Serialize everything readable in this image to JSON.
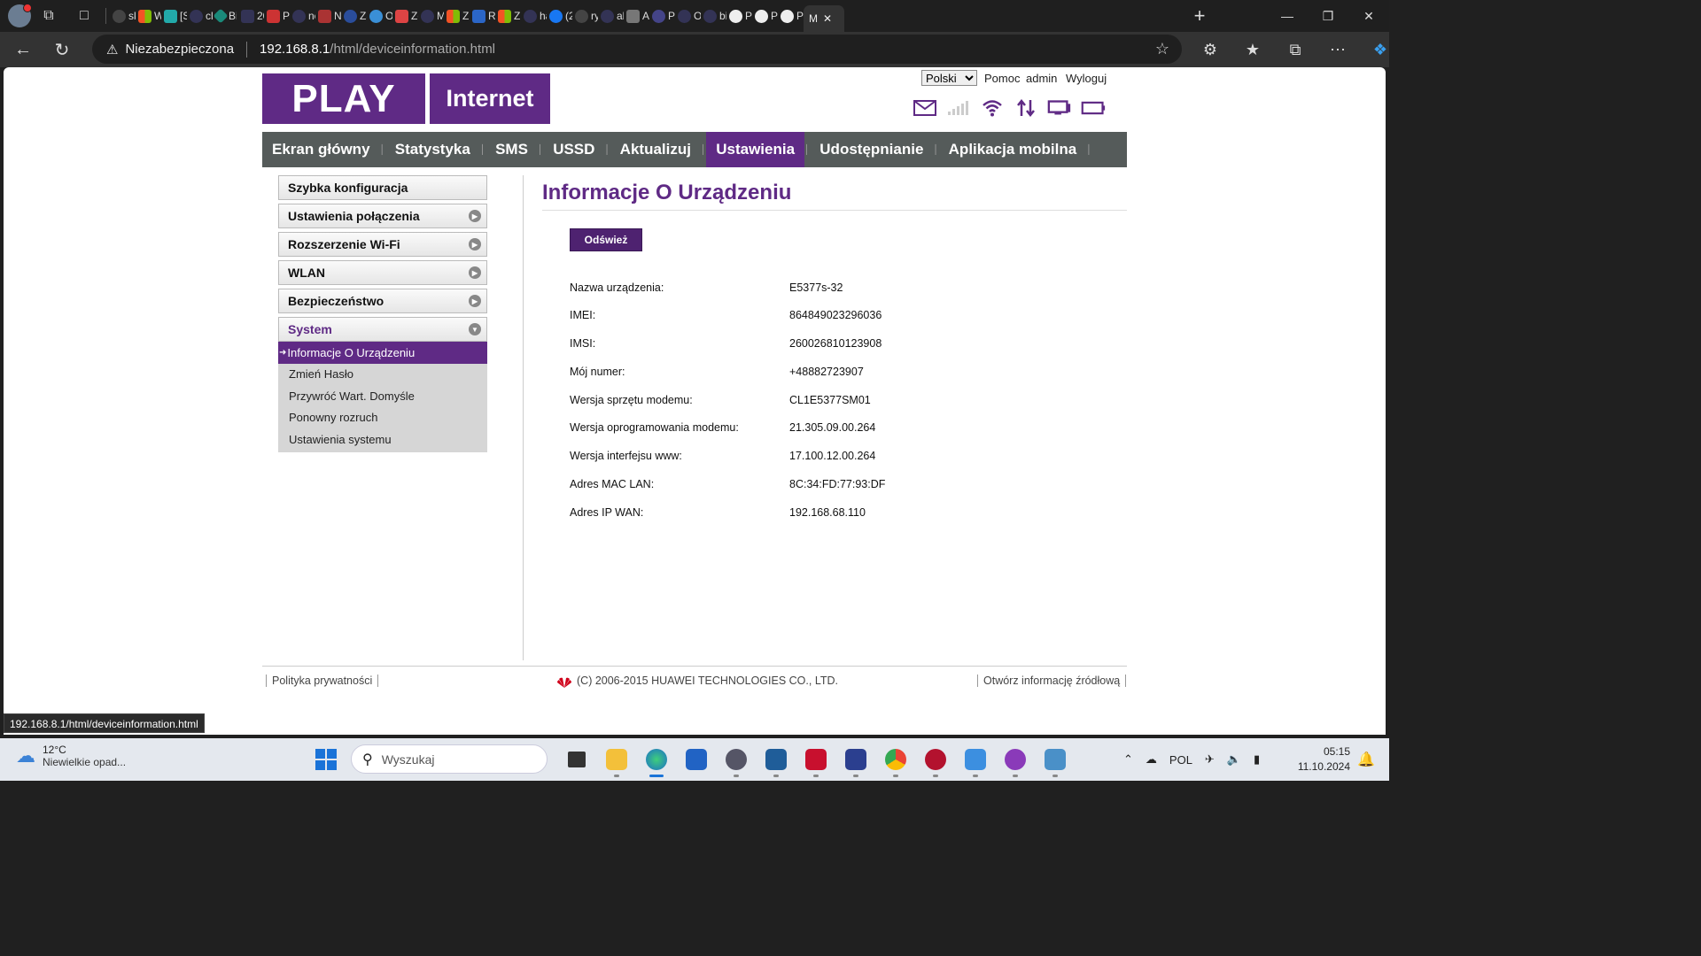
{
  "browser": {
    "active_tab_label": "M",
    "tabs": [
      "sk",
      "W",
      "[S",
      "cl",
      "Bi",
      "20",
      "Pc",
      "nc",
      "N",
      "Za",
      "O",
      "Zc",
      "M",
      "Zi",
      "R",
      "Zi",
      "ha",
      "(2",
      "ry",
      "al",
      "Al",
      "Pi",
      "O",
      "bi",
      "Pi",
      "Pi",
      "Pc"
    ],
    "security_label": "Niezabezpieczona",
    "url_host": "192.168.8.1",
    "url_path": "/html/deviceinformation.html",
    "status_url": "192.168.8.1/html/deviceinformation.html"
  },
  "header": {
    "logo_play": "PLAY",
    "logo_internet": "Internet",
    "language": "Polski",
    "help": "Pomoc",
    "user": "admin",
    "logout": "Wyloguj"
  },
  "nav": {
    "items": [
      "Ekran główny",
      "Statystyka",
      "SMS",
      "USSD",
      "Aktualizuj",
      "Ustawienia",
      "Udostępnianie",
      "Aplikacja mobilna"
    ],
    "active": "Ustawienia"
  },
  "sidebar": {
    "items": [
      "Szybka konfiguracja",
      "Ustawienia połączenia",
      "Rozszerzenie Wi-Fi",
      "WLAN",
      "Bezpieczeństwo",
      "System"
    ],
    "system_sub": [
      "Informacje O Urządzeniu",
      "Zmień Hasło",
      "Przywróć Wart. Domyśle",
      "Ponowny rozruch",
      "Ustawienia systemu"
    ]
  },
  "content": {
    "title": "Informacje O Urządzeniu",
    "refresh": "Odśwież",
    "rows": [
      {
        "label": "Nazwa urządzenia:",
        "value": "E5377s-32"
      },
      {
        "label": "IMEI:",
        "value": "864849023296036"
      },
      {
        "label": "IMSI:",
        "value": "260026810123908"
      },
      {
        "label": "Mój numer:",
        "value": "+48882723907"
      },
      {
        "label": "Wersja sprzętu modemu:",
        "value": "CL1E5377SM01"
      },
      {
        "label": "Wersja oprogramowania modemu:",
        "value": "21.305.09.00.264"
      },
      {
        "label": "Wersja interfejsu www:",
        "value": "17.100.12.00.264"
      },
      {
        "label": "Adres MAC LAN:",
        "value": "8C:34:FD:77:93:DF"
      },
      {
        "label": "Adres IP WAN:",
        "value": "192.168.68.110"
      }
    ]
  },
  "footer": {
    "privacy": "Polityka prywatności",
    "copyright": "(C) 2006-2015 HUAWEI TECHNOLOGIES CO., LTD.",
    "opensource": "Otwórz informację źródłową"
  },
  "taskbar": {
    "temperature": "12°C",
    "weather": "Niewielkie opad...",
    "search_placeholder": "Wyszukaj",
    "language": "POL",
    "time": "05:15",
    "date": "11.10.2024"
  },
  "colors": {
    "brand_purple": "#5f2a85",
    "nav_gray": "#555b5a"
  }
}
